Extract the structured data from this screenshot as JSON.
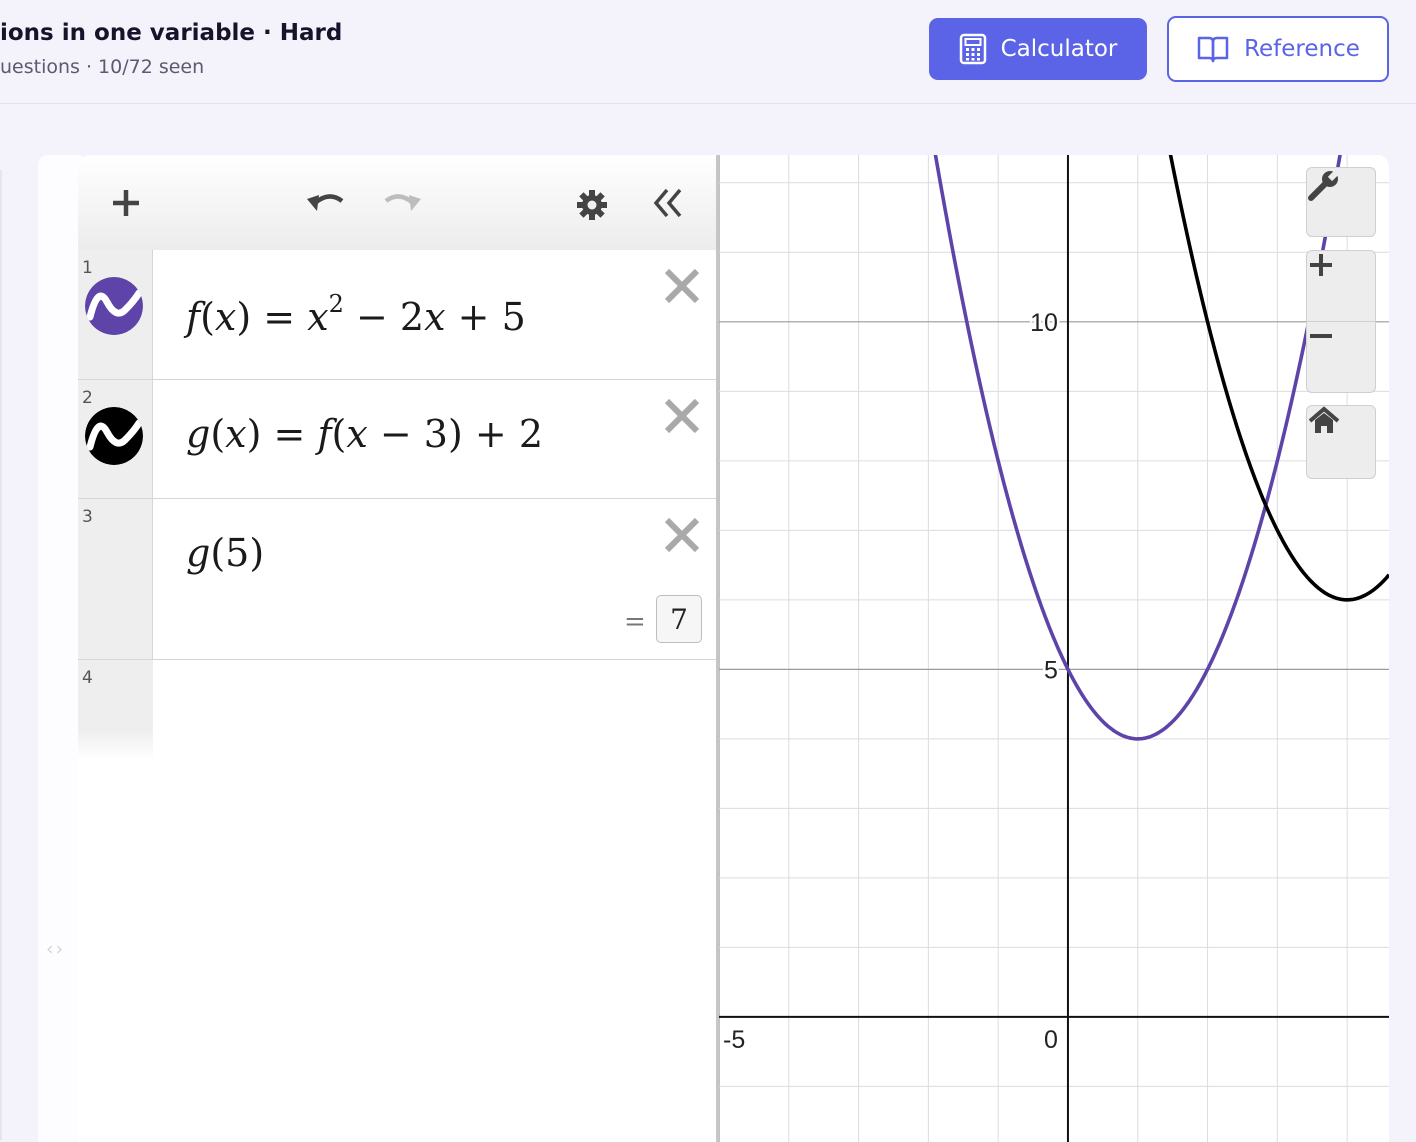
{
  "header": {
    "title": "ions in one variable · Hard",
    "subtitle": "uestions · 10/72 seen",
    "calculator_label": "Calculator",
    "reference_label": "Reference"
  },
  "colors": {
    "accent": "#5b63e6",
    "f_curve": "#5e44a9",
    "g_curve": "#000000"
  },
  "collapse_handle": "‹›",
  "expressions": [
    {
      "num": "1",
      "latex_text": "f(x) = x^2 − 2x + 5",
      "color": "#5e44a9",
      "has_icon": true
    },
    {
      "num": "2",
      "latex_text": "g(x) = f(x − 3) + 2",
      "color": "#000000",
      "has_icon": true
    },
    {
      "num": "3",
      "latex_text": "g(5)",
      "result_eq": "=",
      "result": "7"
    },
    {
      "num": "4"
    }
  ],
  "expr1": {
    "f": "f",
    "lp": "(",
    "x": "x",
    "rp": ")",
    "eq": "=",
    "x2": "x",
    "pow": "2",
    "rest_a": "− 2",
    "rest_x": "x",
    "rest_b": "+ 5"
  },
  "expr2": {
    "g": "g",
    "lp": "(",
    "x": "x",
    "rp": ")",
    "eq": "=",
    "f": "f",
    "lp2": "(",
    "x2": "x",
    "minus3": "− 3",
    "rp2": ")",
    "plus2": "+ 2"
  },
  "expr3": {
    "g": "g",
    "lp": "(",
    "five": "5",
    "rp": ")"
  },
  "graph": {
    "x_range": [
      -5,
      4.6
    ],
    "y_range": [
      -1.8,
      12.4
    ],
    "grid_step": 1,
    "tick_labels": {
      "x": [
        {
          "v": -5,
          "t": "-5"
        }
      ],
      "y": [
        {
          "v": 5,
          "t": "5"
        },
        {
          "v": 10,
          "t": "10"
        }
      ],
      "origin": "0"
    },
    "functions": [
      "f",
      "g"
    ]
  },
  "graph_controls": [
    "wrench-icon",
    "zoom-in-icon",
    "zoom-out-icon",
    "home-icon"
  ]
}
